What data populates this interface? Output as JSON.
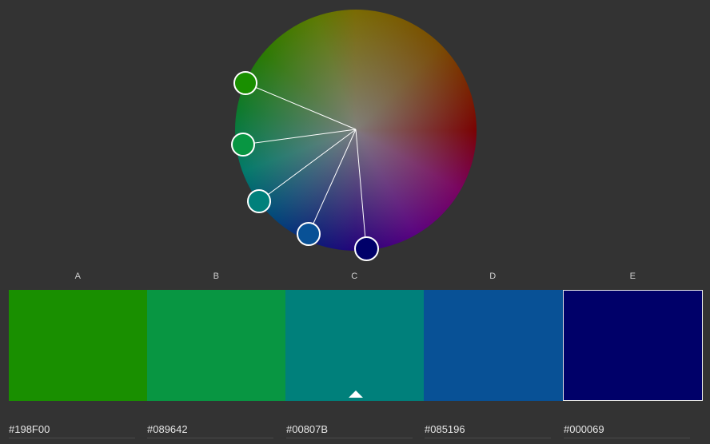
{
  "swatches": [
    {
      "label": "A",
      "hex": "#198F00",
      "color": "#198F00"
    },
    {
      "label": "B",
      "hex": "#089642",
      "color": "#089642"
    },
    {
      "label": "C",
      "hex": "#00807B",
      "color": "#00807B"
    },
    {
      "label": "D",
      "hex": "#085196",
      "color": "#085196"
    },
    {
      "label": "E",
      "hex": "#000069",
      "color": "#000069"
    }
  ],
  "selected_swatch": "C",
  "colors": {
    "background": "#333333",
    "handle_border": "#FFFFFF"
  }
}
